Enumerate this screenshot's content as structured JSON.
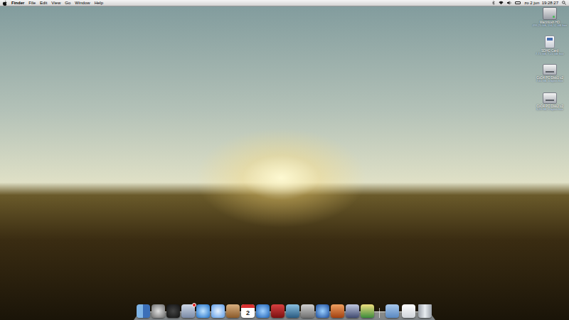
{
  "menu_bar": {
    "app": "Finder",
    "items": [
      "File",
      "Edit",
      "View",
      "Go",
      "Window",
      "Help"
    ],
    "clock": "zo 2 jun  19:28:27"
  },
  "desktop_icons": [
    {
      "name": "Macintosh HD",
      "info": "499,25 GB, 194,52 GB free",
      "kind": "disk"
    },
    {
      "name": "SDHC Card",
      "info": "7,73 GB, 7,21 GB free",
      "kind": "card"
    },
    {
      "name": "CoD4 PC Disk1 v2",
      "info": "7,61 GB, 0 bytes free",
      "kind": "disc"
    },
    {
      "name": "CoD4 PC Disk2 v2",
      "info": "3,28 GB, 0 bytes free",
      "kind": "disc"
    }
  ],
  "dock": [
    {
      "kind": "app",
      "badge": false
    },
    {
      "kind": "app",
      "badge": false
    },
    {
      "kind": "app",
      "badge": false
    },
    {
      "kind": "app",
      "badge": true
    },
    {
      "kind": "app",
      "badge": false
    },
    {
      "kind": "app",
      "badge": false
    },
    {
      "kind": "app",
      "badge": false
    },
    {
      "kind": "calendar",
      "badge": false,
      "text": "2"
    },
    {
      "kind": "app",
      "badge": false
    },
    {
      "kind": "app",
      "badge": false
    },
    {
      "kind": "app",
      "badge": false
    },
    {
      "kind": "app",
      "badge": false
    },
    {
      "kind": "app",
      "badge": false
    },
    {
      "kind": "app",
      "badge": false
    },
    {
      "kind": "app",
      "badge": false
    },
    {
      "kind": "app",
      "badge": false
    },
    {
      "kind": "folder",
      "badge": false
    },
    {
      "kind": "document",
      "badge": false
    },
    {
      "kind": "trash",
      "badge": false
    }
  ]
}
